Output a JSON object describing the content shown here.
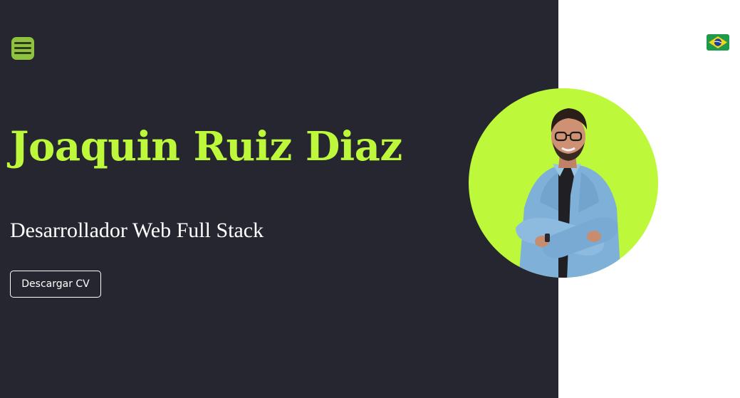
{
  "header": {
    "menu_icon": "hamburger-menu-icon",
    "language_flag_icon": "brazil-flag-icon"
  },
  "hero": {
    "name": "Joaquin Ruiz Diaz",
    "role": "Desarrollador Web Full Stack",
    "cv_button_label": "Descargar CV",
    "photo": "profile-photo"
  },
  "colors": {
    "dark_background": "#262631",
    "light_background": "#ffffff",
    "accent": "#bdf93a",
    "menu_button": "#8fc23f",
    "text_light": "#ffffff"
  }
}
